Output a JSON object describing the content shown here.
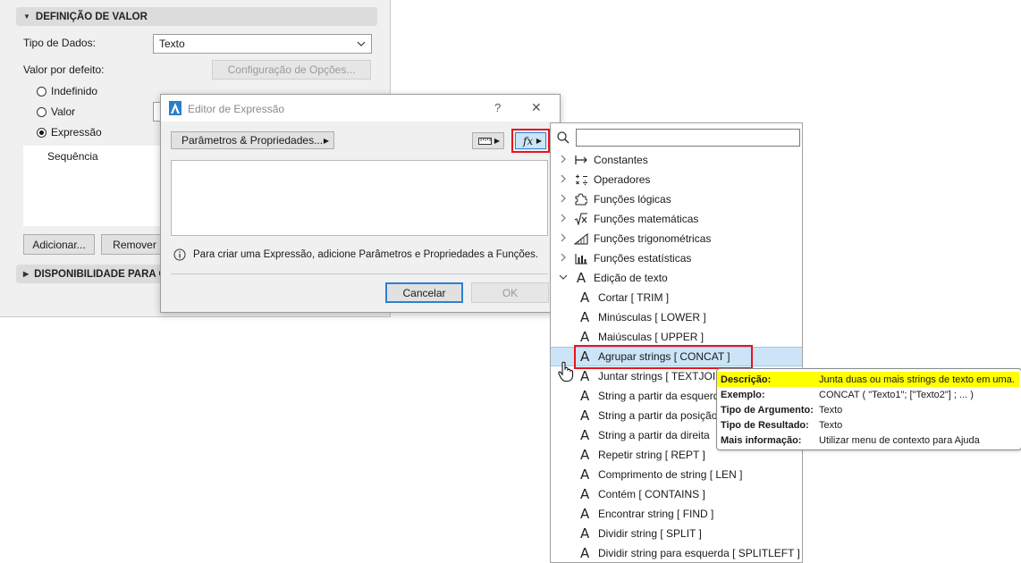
{
  "settings_panel": {
    "section1_title": "DEFINIÇÃO DE VALOR",
    "data_type_label": "Tipo de Dados:",
    "data_type_value": "Texto",
    "default_value_label": "Valor por defeito:",
    "options_config_button": "Configuração de Opções...",
    "radio_undefined": "Indefinido",
    "radio_value": "Valor",
    "radio_expression": "Expressão",
    "selected_radio": "Expressão",
    "sequence_text": "Sequência",
    "add_button": "Adicionar...",
    "remove_button": "Remover",
    "section2_title": "DISPONIBILIDADE PARA CL"
  },
  "dialog": {
    "title": "Editor de Expressão",
    "help_glyph": "?",
    "close_glyph": "✕",
    "params_button": "Parâmetros & Propriedades...",
    "fx_label": "fx",
    "info_text": "Para criar uma Expressão, adicione Parâmetros e Propriedades a Funções.",
    "cancel_button": "Cancelar",
    "ok_button": "OK"
  },
  "function_list": {
    "search_placeholder": "",
    "categories": [
      {
        "label": "Constantes",
        "icon": "arrow-bar-icon",
        "expanded": false
      },
      {
        "label": "Operadores",
        "icon": "operators-icon",
        "expanded": false
      },
      {
        "label": "Funções lógicas",
        "icon": "puzzle-icon",
        "expanded": false
      },
      {
        "label": "Funções matemáticas",
        "icon": "sqrt-icon",
        "expanded": false
      },
      {
        "label": "Funções trigonométricas",
        "icon": "triangle-icon",
        "expanded": false
      },
      {
        "label": "Funções estatísticas",
        "icon": "bar-chart-icon",
        "expanded": false
      },
      {
        "label": "Edição de texto",
        "icon": "text-a-icon",
        "expanded": true
      }
    ],
    "text_functions": [
      "Cortar [ TRIM ]",
      "Minúsculas [ LOWER ]",
      "Maiúsculas [ UPPER ]",
      "Agrupar strings [ CONCAT ]",
      "Juntar strings [ TEXTJOIN ]",
      "String a partir da esquerda",
      "String a partir da posição",
      "String a partir da direita",
      "Repetir string [ REPT ]",
      "Comprimento de string [ LEN ]",
      "Contém [ CONTAINS ]",
      "Encontrar string [ FIND ]",
      "Dividir string [ SPLIT ]",
      "Dividir string para esquerda [ SPLITLEFT ]"
    ],
    "selected_item": "Agrupar strings [ CONCAT ]"
  },
  "tooltip": {
    "rows": [
      {
        "key": "Descrição:",
        "value": "Junta duas ou mais strings de texto em uma."
      },
      {
        "key": "Exemplo:",
        "value": "CONCAT ( \"Texto1\"; [\"Texto2\"] ; ... )"
      },
      {
        "key": "Tipo de Argumento:",
        "value": "Texto"
      },
      {
        "key": "Tipo de Resultado:",
        "value": "Texto"
      },
      {
        "key": "Mais informação:",
        "value": "Utilizar menu de contexto para Ajuda"
      }
    ]
  },
  "colors": {
    "highlight_box": "#e8141c",
    "selection_bg": "#cce4f7",
    "tooltip_highlight": "#ffff00",
    "primary_button_border": "#2f7fd1"
  }
}
